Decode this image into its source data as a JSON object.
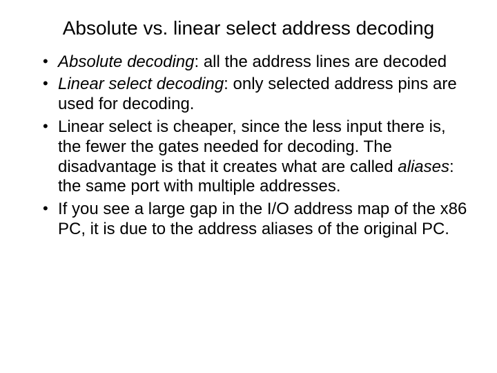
{
  "slide": {
    "title": "Absolute vs. linear select address decoding",
    "bullets": [
      {
        "term": "Absolute decoding",
        "rest": ": all the address lines are decoded"
      },
      {
        "term": "Linear select decoding",
        "rest": ": only selected address pins are used for decoding."
      },
      {
        "plain_a": "Linear select is cheaper, since the less input there is, the fewer the gates needed for decoding. The disadvantage is that it creates what are called ",
        "term": "aliases",
        "plain_b": ": the same port with multiple addresses."
      },
      {
        "plain_a": "If you see a large gap in the I/O address map of the x86 PC, it is due to the address aliases of the original PC."
      }
    ]
  }
}
